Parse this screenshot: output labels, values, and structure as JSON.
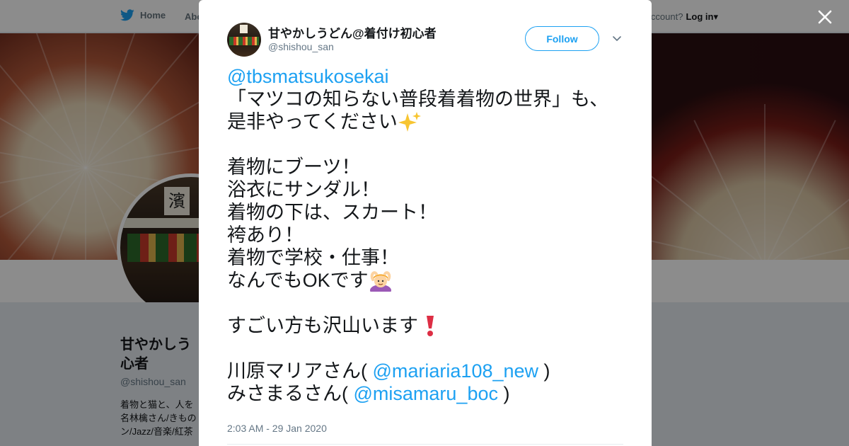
{
  "nav": {
    "home_label": "Home",
    "about_label": "Abo",
    "account_text": "account?",
    "login_label": "Log in"
  },
  "profile": {
    "name": "甘やかしうどん@着付け初心者",
    "name_visible": "甘やかしう 心者",
    "handle": "@shishou_san",
    "bio_visible": "着物と猫と、人を 名林檎さん/きもの ン/Jazz/音楽/紅茶",
    "avatar_sign_text": "濱"
  },
  "tweet": {
    "author_name": "甘やかしうどん@着付け初心者",
    "author_handle": "@shishou_san",
    "follow_label": "Follow",
    "lines": [
      {
        "mention": "@tbsmatsukosekai"
      },
      {
        "text": "「マツコの知らない普段着着物の世界」も、"
      },
      {
        "text": "是非やってください",
        "emoji": "sparkles"
      },
      {
        "gap": true
      },
      {
        "text": "着物にブーツ！"
      },
      {
        "text": "浴衣にサンダル！"
      },
      {
        "text": "着物の下は、スカート！"
      },
      {
        "text": "袴あり！"
      },
      {
        "text": "着物で学校・仕事！"
      },
      {
        "text": "なんでもOKです",
        "emoji": "person-gesturing-ok"
      },
      {
        "gap": true
      },
      {
        "text": "すごい方も沢山います",
        "emoji": "heavy-exclamation-mark"
      },
      {
        "gap": true
      },
      {
        "prefix": "川原マリアさん( ",
        "mention": "@mariaria108_new",
        "suffix": " )"
      },
      {
        "prefix": "みさまるさん( ",
        "mention": "@misamaru_boc",
        "suffix": " )"
      }
    ],
    "timestamp": "2:03 AM - 29 Jan 2020"
  },
  "colors": {
    "accent": "#1da1f2",
    "text": "#14171a",
    "muted": "#657786",
    "overlay": "rgba(0,0,0,0.45)"
  },
  "icons": {
    "logo": "twitter-bird-icon",
    "close": "close-icon",
    "caret": "chevron-down-icon"
  }
}
